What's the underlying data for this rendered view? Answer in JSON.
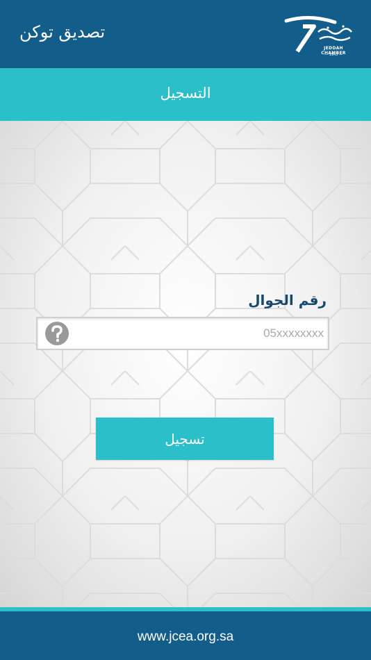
{
  "header": {
    "title": "تصديق توكن",
    "logo_text_en": "JEDDAH CHAMBER",
    "logo_year": "— 1943 —",
    "logo_icon": "jeddah-chamber-logo"
  },
  "subheader": {
    "title": "التسجيل"
  },
  "form": {
    "phone_label": "رقم الجوال",
    "phone_placeholder": "05xxxxxxxx",
    "phone_value": "",
    "help_icon": "question-mark-icon",
    "submit_label": "تسجيل"
  },
  "footer": {
    "url": "www.jcea.org.sa"
  },
  "colors": {
    "primary": "#125d8a",
    "accent": "#2bbfc9",
    "label": "#17496f"
  }
}
